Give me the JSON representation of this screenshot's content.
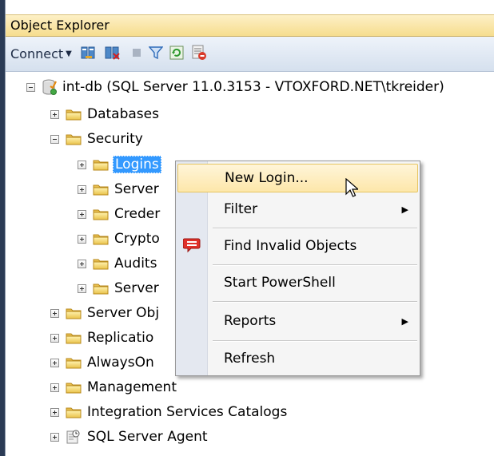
{
  "panel": {
    "title": "Object Explorer"
  },
  "toolbar": {
    "connect_label": "Connect",
    "icons": [
      "connect-object-explorer-icon",
      "disconnect-icon",
      "stop-icon",
      "filter-icon",
      "refresh-icon",
      "summary-icon"
    ]
  },
  "tree": {
    "server": "int-db (SQL Server 11.0.3153 - VTOXFORD.NET\\tkreider)",
    "databases": "Databases",
    "security": "Security",
    "logins": "Logins",
    "server_roles": "Server",
    "credentials": "Creder",
    "cryptographic": "Crypto",
    "audits": "Audits",
    "server_audit_specs": "Server",
    "server_objects": "Server Obj",
    "replication": "Replicatio",
    "alwayson": "AlwaysOn",
    "management": "Management",
    "integration_services": "Integration Services Catalogs",
    "sql_agent": "SQL Server Agent"
  },
  "context_menu": {
    "new_login": "New Login...",
    "filter": "Filter",
    "find_invalid": "Find Invalid Objects",
    "powershell": "Start PowerShell",
    "reports": "Reports",
    "refresh": "Refresh"
  },
  "colors": {
    "selection": "#3399ff",
    "menu_highlight": "#fde7aa",
    "title_bar": "#f6dd8e",
    "toolbar": "#d5e0ee"
  }
}
